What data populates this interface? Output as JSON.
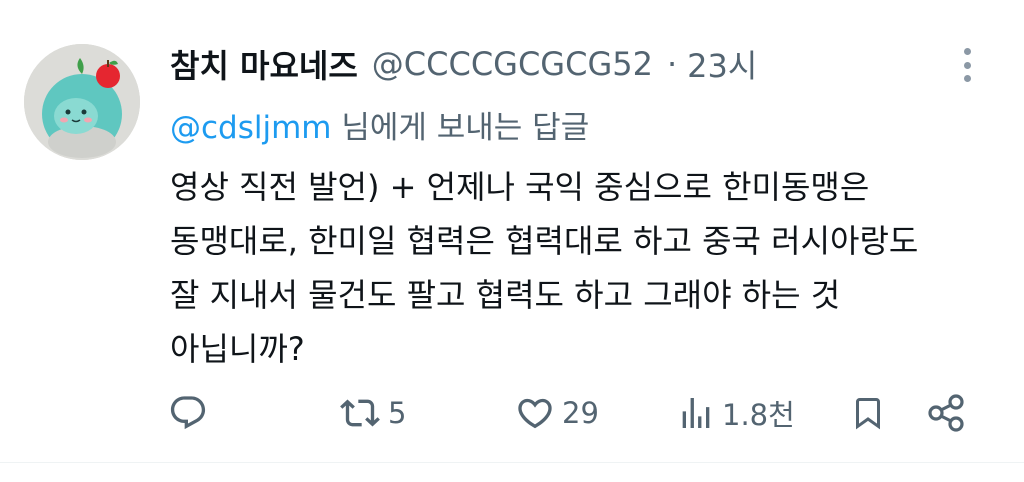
{
  "tweet": {
    "display_name": "참치 마요네즈",
    "handle": "@CCCCGCGCG52",
    "separator": "·",
    "time": "23시",
    "reply_to": {
      "mention": "@cdsljmm",
      "suffix": " 님에게 보내는 답글"
    },
    "text_lines": [
      "영상 직전 발언) + 언제나 국익 중심으로 한미동맹은",
      "동맹대로, 한미일 협력은 협력대로 하고 중국 러시아랑도",
      "잘 지내서 물건도 팔고 협력도 하고 그래야 하는 것",
      "아닙니까?"
    ],
    "actions": {
      "reply_icon": "reply-icon",
      "retweet_icon": "retweet-icon",
      "retweet_count": "5",
      "like_icon": "heart-icon",
      "like_count": "29",
      "views_icon": "views-icon",
      "views_count": "1.8천",
      "bookmark_icon": "bookmark-icon",
      "share_icon": "share-icon"
    },
    "more_icon": "more-vertical-icon"
  },
  "colors": {
    "text": "#0f1419",
    "secondary": "#536471",
    "link": "#1d9bf0",
    "icon": "#536471"
  }
}
